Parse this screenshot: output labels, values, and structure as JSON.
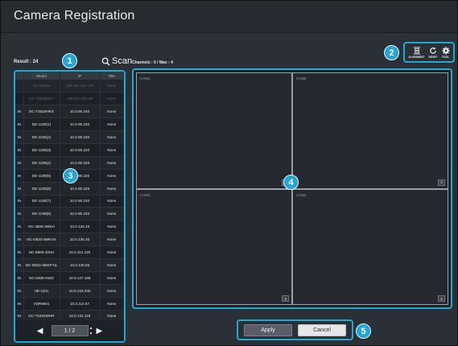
{
  "window": {
    "title": "Camera Registration"
  },
  "left": {
    "result_text": "Result : 24",
    "scan_label": "Scan",
    "columns": [
      "",
      "Model",
      "IP",
      "Title"
    ],
    "rows": [
      {
        "ch": "",
        "model": "SC-B2193",
        "ip": "169.254.193.170",
        "title": "None",
        "disabled": true
      },
      {
        "ch": "",
        "model": "DC-T3633HRX",
        "ip": "169.254.253.99",
        "title": "None",
        "disabled": true
      },
      {
        "ch": "IN",
        "model": "DC-T3633HRX",
        "ip": "10.0.90.240",
        "title": "None"
      },
      {
        "ch": "IN",
        "model": "DE-1108(1)",
        "ip": "10.0.90.220",
        "title": "None"
      },
      {
        "ch": "IN",
        "model": "DE-1108(2)",
        "ip": "10.0.90.220",
        "title": "None"
      },
      {
        "ch": "IN",
        "model": "DE-1108(3)",
        "ip": "10.0.90.220",
        "title": "None"
      },
      {
        "ch": "IN",
        "model": "DE-1108(4)",
        "ip": "10.0.90.220",
        "title": "None"
      },
      {
        "ch": "IN",
        "model": "DE-1108(5)",
        "ip": "10.0.90.220",
        "title": "None"
      },
      {
        "ch": "IN",
        "model": "DE-1108(6)",
        "ip": "10.0.90.220",
        "title": "None"
      },
      {
        "ch": "IN",
        "model": "DE-1108(7)",
        "ip": "10.0.90.220",
        "title": "None"
      },
      {
        "ch": "IN",
        "model": "DE-1108(8)",
        "ip": "10.0.90.220",
        "title": "None"
      },
      {
        "ch": "IN",
        "model": "NC-4606-3MKH",
        "ip": "10.0.134.16",
        "title": "None"
      },
      {
        "ch": "IN",
        "model": "NC-D820-3MKHS",
        "ip": "10.0.135.20",
        "title": "None"
      },
      {
        "ch": "IN",
        "model": "NC-5806-32KH",
        "ip": "10.0.112.120",
        "title": "None"
      },
      {
        "ch": "IN",
        "model": "NC-D822-3MKP-5L",
        "ip": "10.0.130.65",
        "title": "None"
      },
      {
        "ch": "IN",
        "model": "NC-5405-KWD",
        "ip": "10.0.127.168",
        "title": "None"
      },
      {
        "ch": "IN",
        "model": "HE-1101",
        "ip": "10.0.123.236",
        "title": "None"
      },
      {
        "ch": "IN",
        "model": "VDR6601",
        "ip": "10.0.112.67",
        "title": "None"
      },
      {
        "ch": "IN",
        "model": "DC-T1833WHR",
        "ip": "10.0.131.119",
        "title": "None"
      }
    ],
    "pager": {
      "page": "1 / 2"
    }
  },
  "right": {
    "channels_text": "Channels : 0 / Max : 4",
    "tools": [
      {
        "label": "ALIGNMENT",
        "icon": "alignment-icon"
      },
      {
        "label": "RESET",
        "icon": "reset-icon"
      },
      {
        "label": "TOOL",
        "icon": "gear-icon"
      }
    ],
    "cells": [
      {
        "label": "CAM1",
        "num": "2"
      },
      {
        "label": "CAM2",
        "num": "2"
      },
      {
        "label": "CAM3",
        "num": "3"
      },
      {
        "label": "CAM4",
        "num": "4"
      }
    ]
  },
  "buttons": {
    "apply": "Apply",
    "cancel": "Cancel"
  },
  "markers": [
    "1",
    "2",
    "3",
    "4",
    "5"
  ],
  "colors": {
    "accent": "#1fa9d3",
    "marker": "#23a6d4",
    "background": "#2b3037"
  }
}
